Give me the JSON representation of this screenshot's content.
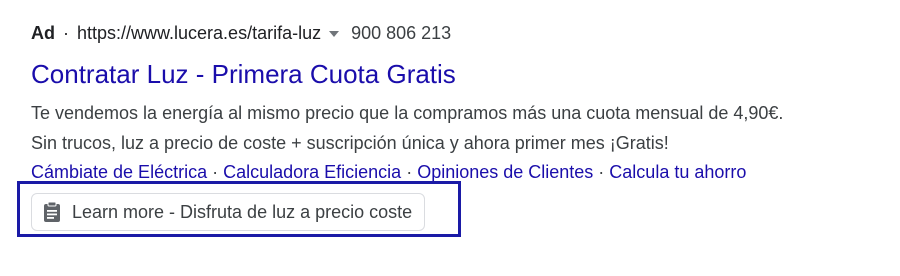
{
  "ad": {
    "badge": "Ad",
    "separator": "·",
    "url": "https://www.lucera.es/tarifa-luz",
    "phone": "900 806 213",
    "title": "Contratar Luz - Primera Cuota Gratis",
    "description_line1": "Te vendemos la energía al mismo precio que la compramos más una cuota mensual de 4,90€.",
    "description_line2": "Sin trucos, luz a precio de coste + suscripción única y ahora primer mes ¡Gratis!",
    "sitelinks": [
      "Cámbiate de Eléctrica",
      "Calculadora Eficiencia",
      "Opiniones de Clientes",
      "Calcula tu ahorro"
    ],
    "sitelink_separator": "·",
    "learn_more_label": "Learn more - Disfruta de luz a precio coste",
    "learn_more_icon": "clipboard-icon"
  },
  "colors": {
    "link": "#1a0dab",
    "text": "#3c4043",
    "highlight_border": "#1a1aa6"
  }
}
